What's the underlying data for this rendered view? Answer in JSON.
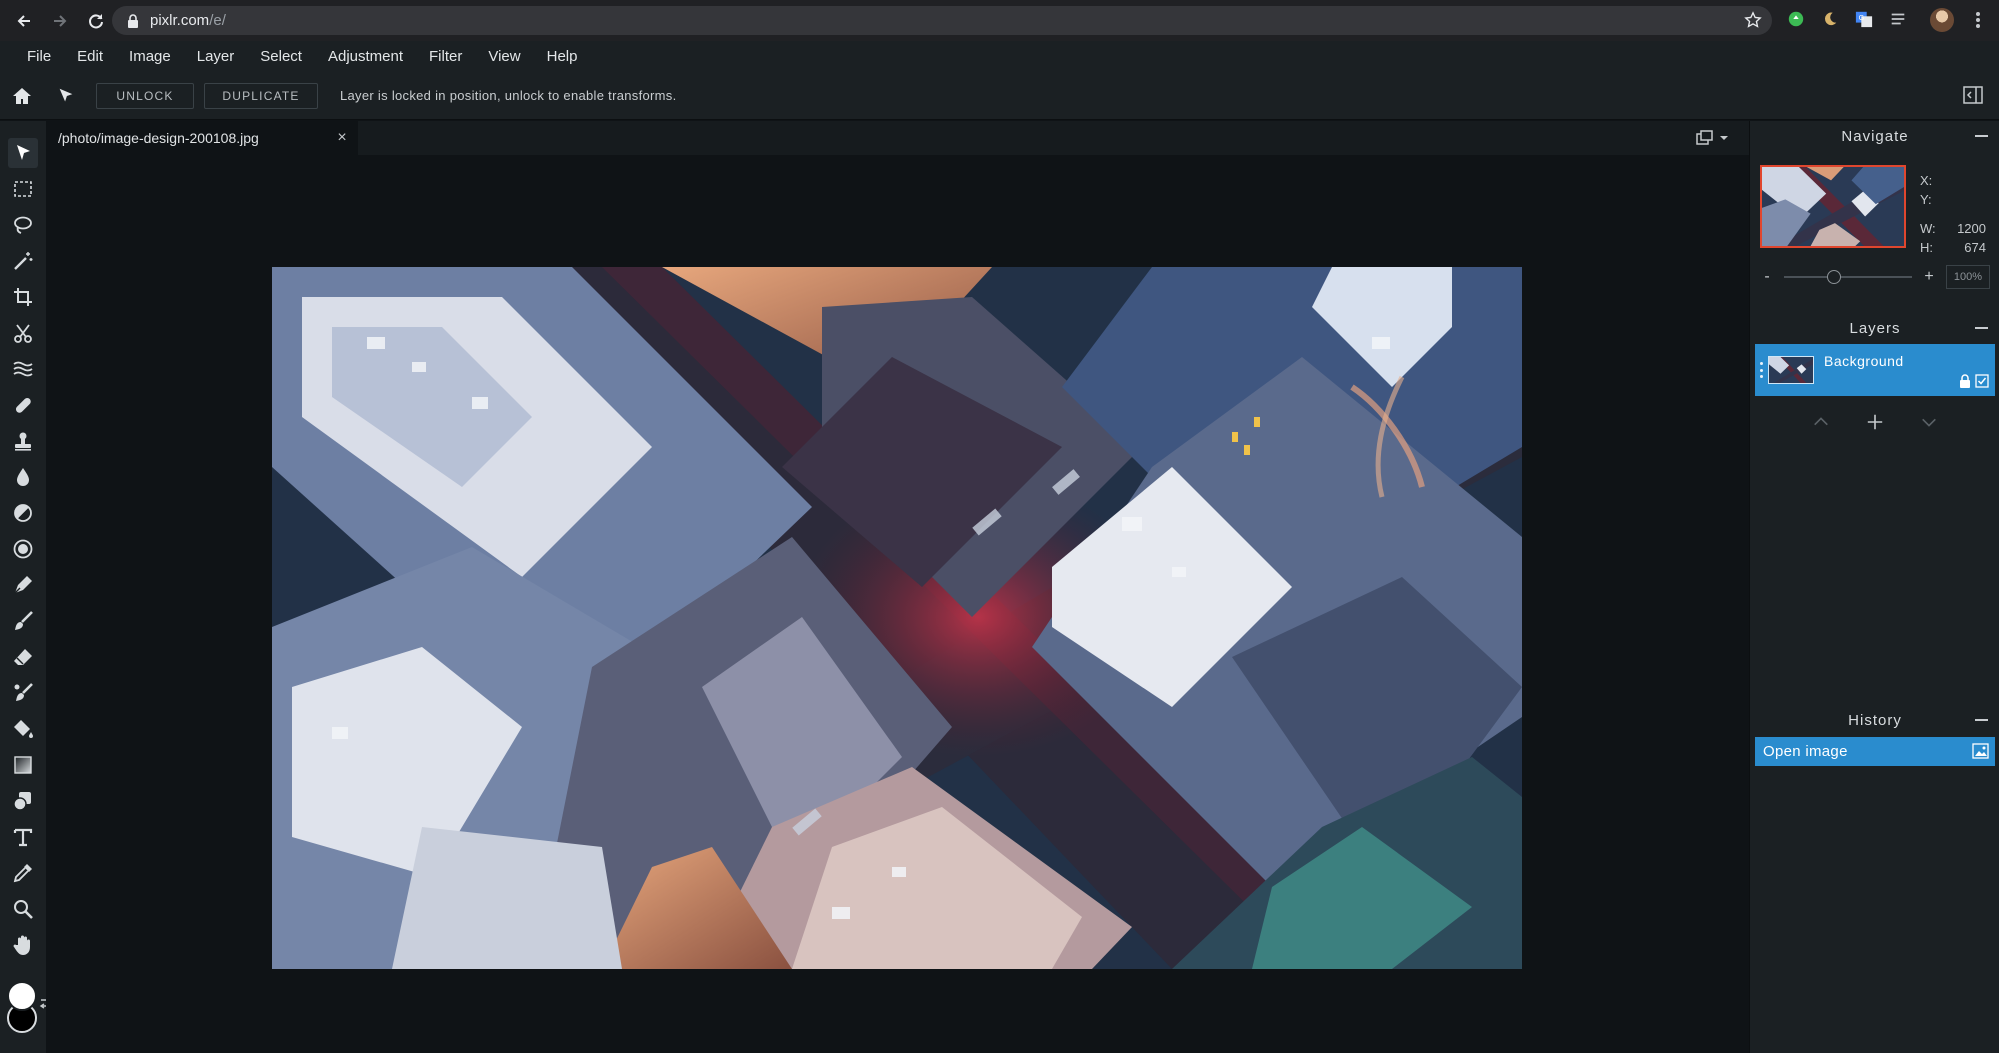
{
  "browser": {
    "url_host": "pixlr.com",
    "url_path": "/e/",
    "back_icon": "arrow-left-icon",
    "forward_icon": "arrow-right-icon",
    "reload_icon": "reload-icon",
    "lock_icon": "lock-icon",
    "bookmark_icon": "star-icon"
  },
  "menu": {
    "items": [
      "File",
      "Edit",
      "Image",
      "Layer",
      "Select",
      "Adjustment",
      "Filter",
      "View",
      "Help"
    ]
  },
  "options_bar": {
    "unlock_label": "UNLOCK",
    "duplicate_label": "DUPLICATE",
    "message": "Layer is locked in position, unlock to enable transforms."
  },
  "document": {
    "tab_title": "/photo/image-design-200108.jpg",
    "close_glyph": "×"
  },
  "toolbar": {
    "tools": [
      "arrange-tool-icon",
      "marquee-icon",
      "lasso-icon",
      "magic-wand-icon",
      "crop-icon",
      "cutout-icon",
      "liquify-icon",
      "heal-icon",
      "clone-stamp-icon",
      "blur-icon",
      "sponge-icon",
      "dodge-burn-icon",
      "pen-icon",
      "brush-icon",
      "eraser-icon",
      "color-replace-icon",
      "fill-bucket-icon",
      "gradient-icon",
      "shape-icon",
      "text-icon",
      "eyedropper-icon",
      "zoom-icon",
      "hand-icon"
    ],
    "foreground_color": "#ffffff",
    "background_color": "#000000"
  },
  "navigate": {
    "title": "Navigate",
    "x_label": "X:",
    "x_value": "",
    "y_label": "Y:",
    "y_value": "",
    "w_label": "W:",
    "w_value": "1200",
    "h_label": "H:",
    "h_value": "674",
    "zoom_minus": "-",
    "zoom_plus": "+",
    "zoom_value": "100%",
    "zoom_level": 0.38
  },
  "layers": {
    "title": "Layers",
    "items": [
      {
        "name": "Background",
        "locked": true,
        "visible": true
      }
    ]
  },
  "history": {
    "title": "History",
    "items": [
      {
        "label": "Open image"
      }
    ]
  },
  "colors": {
    "accent": "#2a8cce",
    "panel": "#1b2023",
    "canvas": "#0f1316",
    "nav_frame": "#e0462e"
  }
}
